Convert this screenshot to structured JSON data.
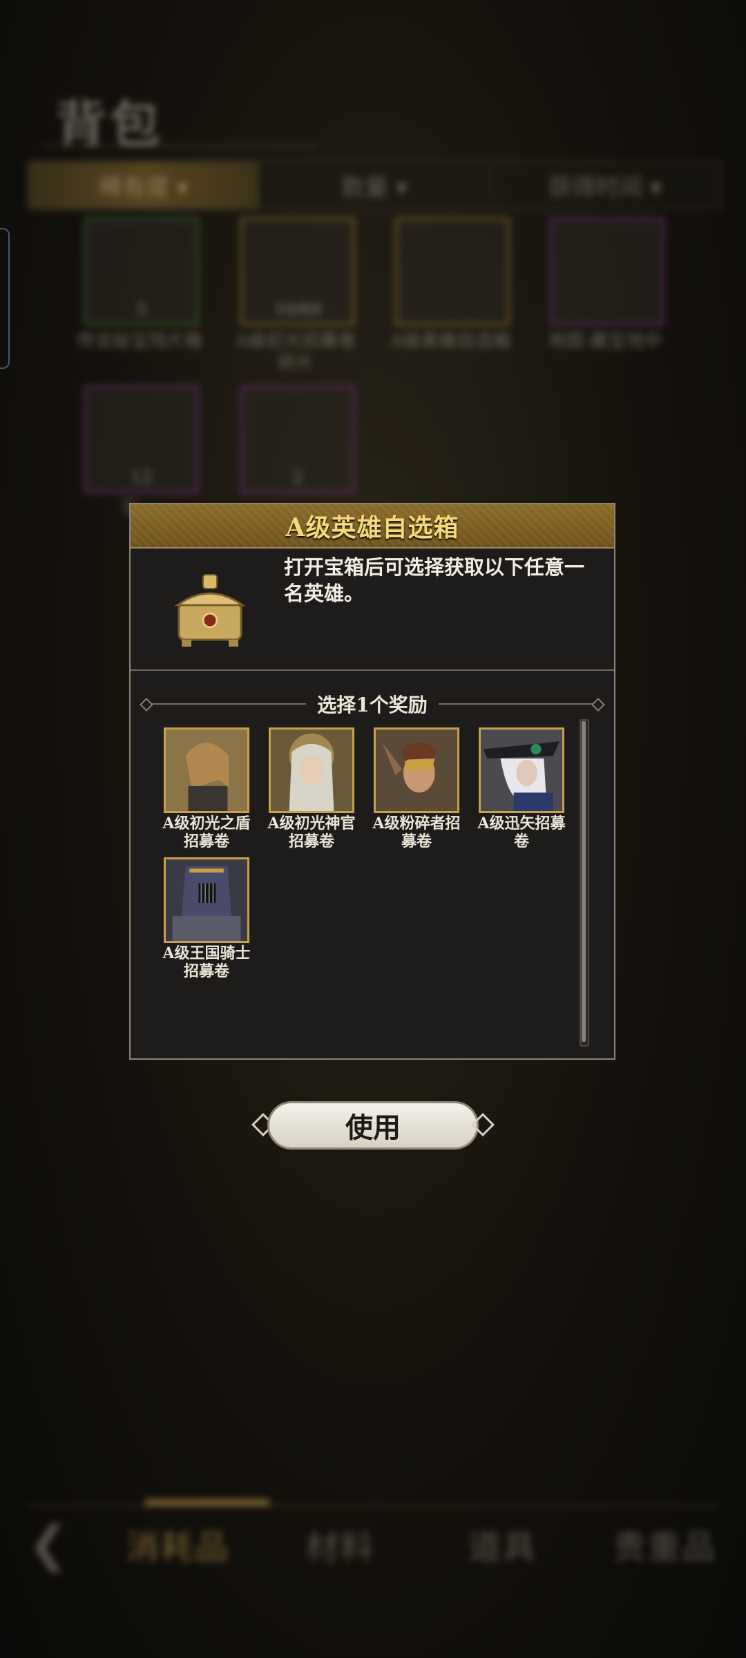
{
  "background": {
    "page_title": "背包",
    "sort_tabs": [
      {
        "label": "稀有度 ▾",
        "active": true
      },
      {
        "label": "数量 ▾",
        "active": false
      },
      {
        "label": "获得时间 ▾",
        "active": false
      }
    ],
    "items": [
      {
        "count": "5",
        "label": "传说秘宝残片箱",
        "border": "#4a9a3a"
      },
      {
        "count": "10/60",
        "label": "A级初光招募卷碎片",
        "border": "#c9a040"
      },
      {
        "count": "",
        "label": "A级英雄自选箱",
        "border": "#c9a040"
      },
      {
        "count": "",
        "label": "地图·藏宝地中",
        "border": "#9a3ab0"
      },
      {
        "count": "12",
        "label": "引…",
        "border": "#9a3ab0"
      },
      {
        "count": "2",
        "label": "",
        "border": "#9a3ab0"
      }
    ],
    "bottom_nav": [
      {
        "label": "消耗品",
        "active": true
      },
      {
        "label": "材料",
        "active": false
      },
      {
        "label": "道具",
        "active": false
      },
      {
        "label": "贵重品",
        "active": false
      }
    ]
  },
  "dialog": {
    "title": "A级英雄自选箱",
    "description": "打开宝箱后可选择获取以下任意一名英雄。",
    "reward_section_title": "选择1个奖励",
    "rewards": [
      {
        "label": "A级初光之盾招募卷",
        "icon": "hero-portrait-shield"
      },
      {
        "label": "A级初光神官招募卷",
        "icon": "hero-portrait-priest"
      },
      {
        "label": "A级粉碎者招募卷",
        "icon": "hero-portrait-crusher"
      },
      {
        "label": "A级迅矢招募卷",
        "icon": "hero-portrait-archer"
      },
      {
        "label": "A级王国骑士招募卷",
        "icon": "hero-portrait-knight"
      }
    ]
  },
  "use_button": {
    "label": "使用"
  },
  "colors": {
    "gold": "#c9a04a",
    "title_gold": "#f5d97a",
    "dialog_bg": "#1e1c1a"
  }
}
